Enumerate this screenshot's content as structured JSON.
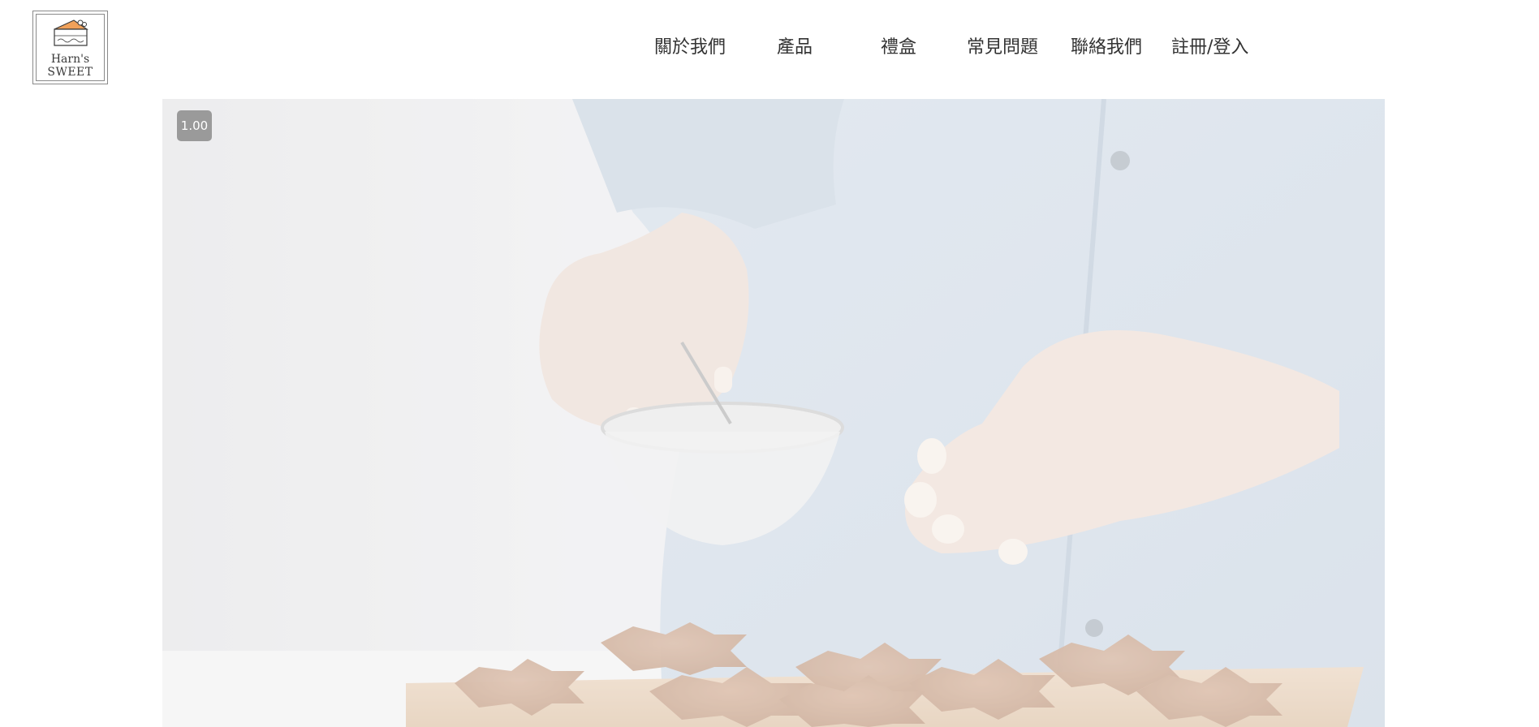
{
  "brand": {
    "logo_line1": "Harn's",
    "logo_line2": "SWEET"
  },
  "nav": {
    "items": [
      {
        "label": "關於我們"
      },
      {
        "label": "產品"
      },
      {
        "label": "禮盒"
      },
      {
        "label": "常見問題"
      },
      {
        "label": "聯絡我們"
      },
      {
        "label": "註冊/登入"
      }
    ]
  },
  "hero": {
    "playback_rate": "1.00"
  },
  "colors": {
    "logo_accent": "#f0a15a",
    "nav_text": "#333333",
    "hero_wash": "#eceff2"
  }
}
